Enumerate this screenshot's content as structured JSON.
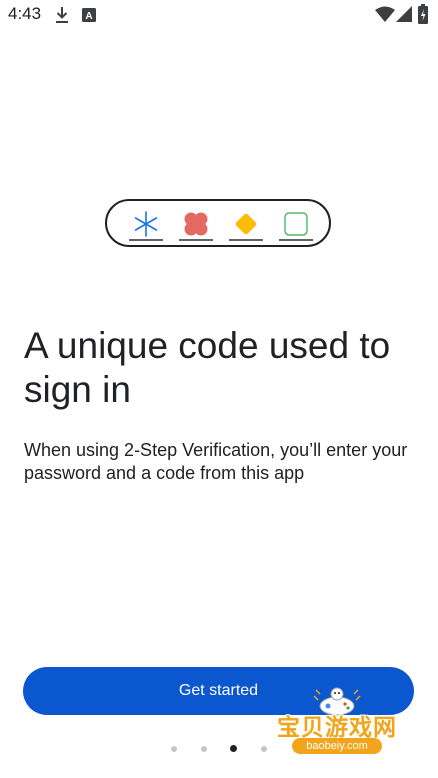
{
  "status_bar": {
    "time": "4:43",
    "icons": [
      "download-icon",
      "a-notification-icon",
      "wifi-icon",
      "signal-icon",
      "battery-icon"
    ]
  },
  "illustration": {
    "items": [
      "asterisk-icon",
      "flower-shape-icon",
      "diamond-shape-icon",
      "rounded-square-icon"
    ],
    "colors": {
      "asterisk": "#1a73e8",
      "flower": "#e46962",
      "diamond": "#fbbc04",
      "square": "#34a853"
    }
  },
  "onboarding": {
    "headline": "A unique code used to sign in",
    "body": "When using 2-Step Verification, you’ll enter your password and a code from this app"
  },
  "get_started_button": {
    "label": "Get started",
    "color": "#0b57d0"
  },
  "page_indicator": {
    "total": 4,
    "active_index": 2
  },
  "watermark": {
    "text": "宝贝游戏网",
    "url": "baobeiy.com"
  }
}
